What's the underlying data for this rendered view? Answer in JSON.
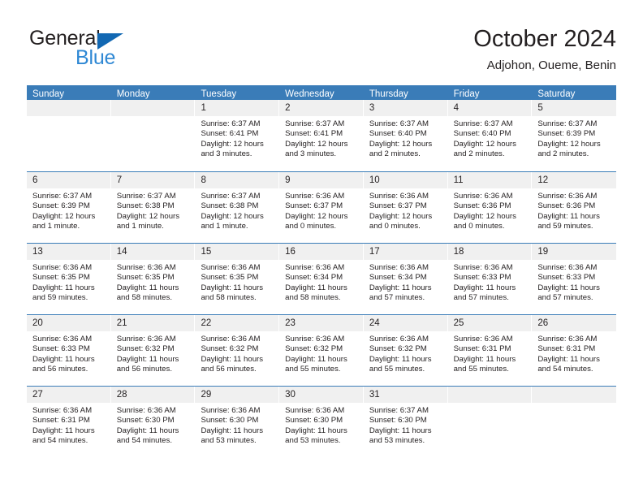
{
  "brand": {
    "name_part1": "General",
    "name_part2": "Blue",
    "triangle_icon": "brand-triangle-icon",
    "color_dark": "#231f20",
    "color_blue": "#2f88d4",
    "color_triangle": "#1268b3"
  },
  "header": {
    "title": "October 2024",
    "subtitle": "Adjohon, Oueme, Benin"
  },
  "theme": {
    "header_bg": "#3a7cb8",
    "header_text": "#ffffff",
    "daynum_bg": "#f0f0f0",
    "row_divider": "#3a7cb8"
  },
  "weekdays": [
    {
      "label": "Sunday"
    },
    {
      "label": "Monday"
    },
    {
      "label": "Tuesday"
    },
    {
      "label": "Wednesday"
    },
    {
      "label": "Thursday"
    },
    {
      "label": "Friday"
    },
    {
      "label": "Saturday"
    }
  ],
  "weeks": [
    [
      {
        "day": "",
        "sunrise": "",
        "sunset": "",
        "daylight1": "",
        "daylight2": ""
      },
      {
        "day": "",
        "sunrise": "",
        "sunset": "",
        "daylight1": "",
        "daylight2": ""
      },
      {
        "day": "1",
        "sunrise": "Sunrise: 6:37 AM",
        "sunset": "Sunset: 6:41 PM",
        "daylight1": "Daylight: 12 hours",
        "daylight2": "and 3 minutes."
      },
      {
        "day": "2",
        "sunrise": "Sunrise: 6:37 AM",
        "sunset": "Sunset: 6:41 PM",
        "daylight1": "Daylight: 12 hours",
        "daylight2": "and 3 minutes."
      },
      {
        "day": "3",
        "sunrise": "Sunrise: 6:37 AM",
        "sunset": "Sunset: 6:40 PM",
        "daylight1": "Daylight: 12 hours",
        "daylight2": "and 2 minutes."
      },
      {
        "day": "4",
        "sunrise": "Sunrise: 6:37 AM",
        "sunset": "Sunset: 6:40 PM",
        "daylight1": "Daylight: 12 hours",
        "daylight2": "and 2 minutes."
      },
      {
        "day": "5",
        "sunrise": "Sunrise: 6:37 AM",
        "sunset": "Sunset: 6:39 PM",
        "daylight1": "Daylight: 12 hours",
        "daylight2": "and 2 minutes."
      }
    ],
    [
      {
        "day": "6",
        "sunrise": "Sunrise: 6:37 AM",
        "sunset": "Sunset: 6:39 PM",
        "daylight1": "Daylight: 12 hours",
        "daylight2": "and 1 minute."
      },
      {
        "day": "7",
        "sunrise": "Sunrise: 6:37 AM",
        "sunset": "Sunset: 6:38 PM",
        "daylight1": "Daylight: 12 hours",
        "daylight2": "and 1 minute."
      },
      {
        "day": "8",
        "sunrise": "Sunrise: 6:37 AM",
        "sunset": "Sunset: 6:38 PM",
        "daylight1": "Daylight: 12 hours",
        "daylight2": "and 1 minute."
      },
      {
        "day": "9",
        "sunrise": "Sunrise: 6:36 AM",
        "sunset": "Sunset: 6:37 PM",
        "daylight1": "Daylight: 12 hours",
        "daylight2": "and 0 minutes."
      },
      {
        "day": "10",
        "sunrise": "Sunrise: 6:36 AM",
        "sunset": "Sunset: 6:37 PM",
        "daylight1": "Daylight: 12 hours",
        "daylight2": "and 0 minutes."
      },
      {
        "day": "11",
        "sunrise": "Sunrise: 6:36 AM",
        "sunset": "Sunset: 6:36 PM",
        "daylight1": "Daylight: 12 hours",
        "daylight2": "and 0 minutes."
      },
      {
        "day": "12",
        "sunrise": "Sunrise: 6:36 AM",
        "sunset": "Sunset: 6:36 PM",
        "daylight1": "Daylight: 11 hours",
        "daylight2": "and 59 minutes."
      }
    ],
    [
      {
        "day": "13",
        "sunrise": "Sunrise: 6:36 AM",
        "sunset": "Sunset: 6:35 PM",
        "daylight1": "Daylight: 11 hours",
        "daylight2": "and 59 minutes."
      },
      {
        "day": "14",
        "sunrise": "Sunrise: 6:36 AM",
        "sunset": "Sunset: 6:35 PM",
        "daylight1": "Daylight: 11 hours",
        "daylight2": "and 58 minutes."
      },
      {
        "day": "15",
        "sunrise": "Sunrise: 6:36 AM",
        "sunset": "Sunset: 6:35 PM",
        "daylight1": "Daylight: 11 hours",
        "daylight2": "and 58 minutes."
      },
      {
        "day": "16",
        "sunrise": "Sunrise: 6:36 AM",
        "sunset": "Sunset: 6:34 PM",
        "daylight1": "Daylight: 11 hours",
        "daylight2": "and 58 minutes."
      },
      {
        "day": "17",
        "sunrise": "Sunrise: 6:36 AM",
        "sunset": "Sunset: 6:34 PM",
        "daylight1": "Daylight: 11 hours",
        "daylight2": "and 57 minutes."
      },
      {
        "day": "18",
        "sunrise": "Sunrise: 6:36 AM",
        "sunset": "Sunset: 6:33 PM",
        "daylight1": "Daylight: 11 hours",
        "daylight2": "and 57 minutes."
      },
      {
        "day": "19",
        "sunrise": "Sunrise: 6:36 AM",
        "sunset": "Sunset: 6:33 PM",
        "daylight1": "Daylight: 11 hours",
        "daylight2": "and 57 minutes."
      }
    ],
    [
      {
        "day": "20",
        "sunrise": "Sunrise: 6:36 AM",
        "sunset": "Sunset: 6:33 PM",
        "daylight1": "Daylight: 11 hours",
        "daylight2": "and 56 minutes."
      },
      {
        "day": "21",
        "sunrise": "Sunrise: 6:36 AM",
        "sunset": "Sunset: 6:32 PM",
        "daylight1": "Daylight: 11 hours",
        "daylight2": "and 56 minutes."
      },
      {
        "day": "22",
        "sunrise": "Sunrise: 6:36 AM",
        "sunset": "Sunset: 6:32 PM",
        "daylight1": "Daylight: 11 hours",
        "daylight2": "and 56 minutes."
      },
      {
        "day": "23",
        "sunrise": "Sunrise: 6:36 AM",
        "sunset": "Sunset: 6:32 PM",
        "daylight1": "Daylight: 11 hours",
        "daylight2": "and 55 minutes."
      },
      {
        "day": "24",
        "sunrise": "Sunrise: 6:36 AM",
        "sunset": "Sunset: 6:32 PM",
        "daylight1": "Daylight: 11 hours",
        "daylight2": "and 55 minutes."
      },
      {
        "day": "25",
        "sunrise": "Sunrise: 6:36 AM",
        "sunset": "Sunset: 6:31 PM",
        "daylight1": "Daylight: 11 hours",
        "daylight2": "and 55 minutes."
      },
      {
        "day": "26",
        "sunrise": "Sunrise: 6:36 AM",
        "sunset": "Sunset: 6:31 PM",
        "daylight1": "Daylight: 11 hours",
        "daylight2": "and 54 minutes."
      }
    ],
    [
      {
        "day": "27",
        "sunrise": "Sunrise: 6:36 AM",
        "sunset": "Sunset: 6:31 PM",
        "daylight1": "Daylight: 11 hours",
        "daylight2": "and 54 minutes."
      },
      {
        "day": "28",
        "sunrise": "Sunrise: 6:36 AM",
        "sunset": "Sunset: 6:30 PM",
        "daylight1": "Daylight: 11 hours",
        "daylight2": "and 54 minutes."
      },
      {
        "day": "29",
        "sunrise": "Sunrise: 6:36 AM",
        "sunset": "Sunset: 6:30 PM",
        "daylight1": "Daylight: 11 hours",
        "daylight2": "and 53 minutes."
      },
      {
        "day": "30",
        "sunrise": "Sunrise: 6:36 AM",
        "sunset": "Sunset: 6:30 PM",
        "daylight1": "Daylight: 11 hours",
        "daylight2": "and 53 minutes."
      },
      {
        "day": "31",
        "sunrise": "Sunrise: 6:37 AM",
        "sunset": "Sunset: 6:30 PM",
        "daylight1": "Daylight: 11 hours",
        "daylight2": "and 53 minutes."
      },
      {
        "day": "",
        "sunrise": "",
        "sunset": "",
        "daylight1": "",
        "daylight2": ""
      },
      {
        "day": "",
        "sunrise": "",
        "sunset": "",
        "daylight1": "",
        "daylight2": ""
      }
    ]
  ]
}
